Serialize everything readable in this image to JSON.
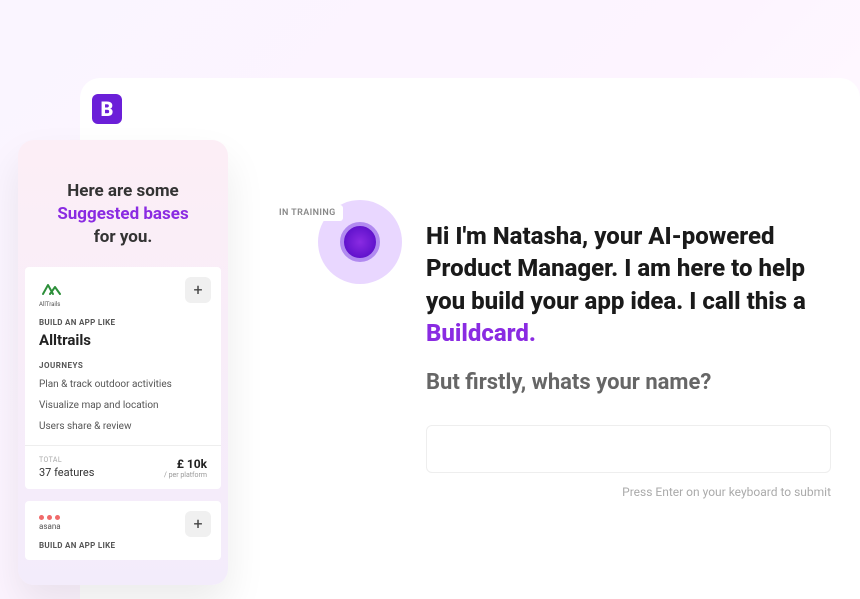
{
  "logo_letter": "B",
  "sidebar": {
    "heading_line1": "Here are some",
    "heading_highlight": "Suggested bases",
    "heading_line3": "for you."
  },
  "bases": [
    {
      "icon_label": "AllTrails",
      "kicker": "BUILD AN APP LIKE",
      "title": "Alltrails",
      "subkicker": "JOURNEYS",
      "features": [
        "Plan & track outdoor activities",
        "Visualize map and location",
        "Users share & review"
      ],
      "total_label": "TOTAL",
      "features_count": "37 features",
      "price": "£ 10k",
      "price_sub": "/ per platform"
    },
    {
      "icon_label": "asana",
      "kicker": "BUILD AN APP LIKE"
    }
  ],
  "chat": {
    "badge": "IN TRAINING",
    "greeting_prefix": "Hi I'm Natasha, your AI-powered Product Manager. I am here to help you build your app idea. I call this a ",
    "greeting_highlight": "Buildcard.",
    "question": "But firstly, whats your name?",
    "input_placeholder": "",
    "hint": "Press Enter on your keyboard to submit"
  }
}
